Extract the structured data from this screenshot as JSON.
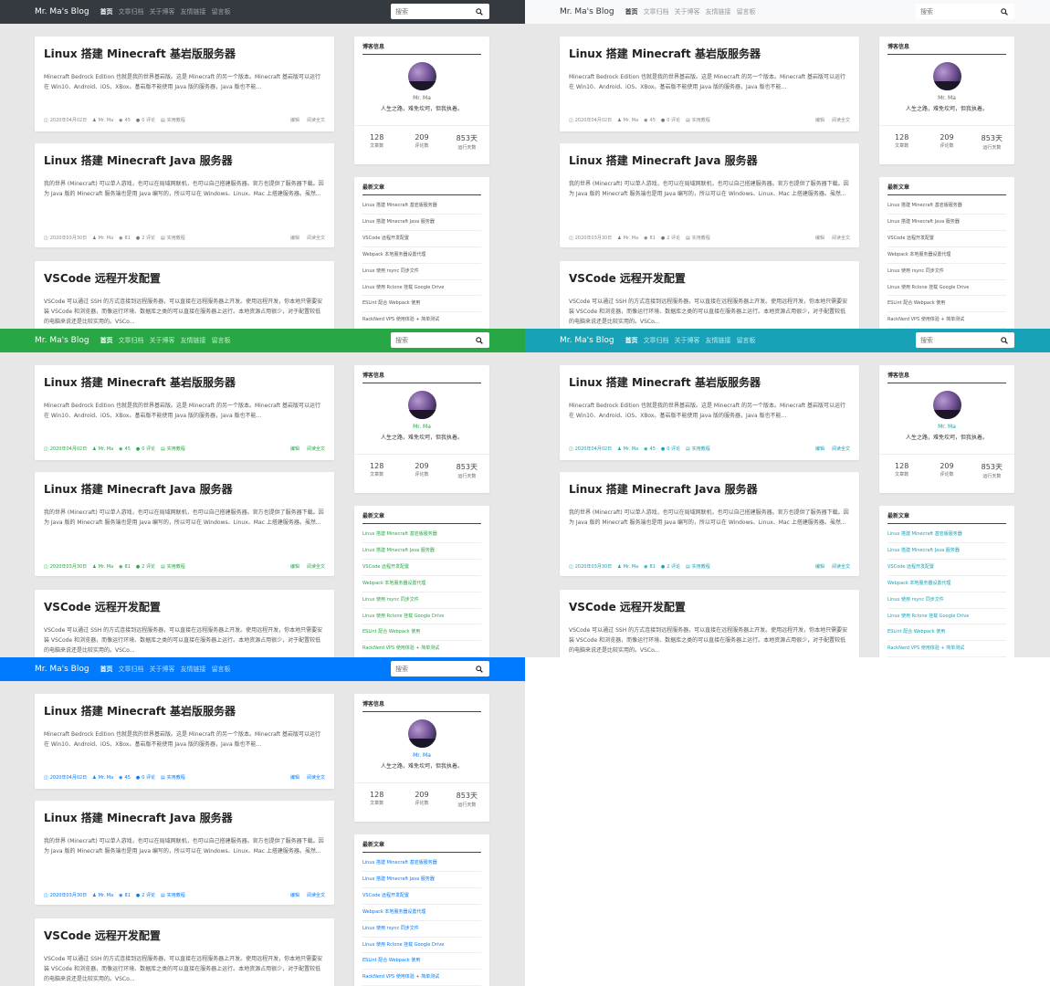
{
  "brand": "Mr. Ma's Blog",
  "nav": [
    "首页",
    "文章归档",
    "关于博客",
    "友情链接",
    "留言板"
  ],
  "search_placeholder": "搜索",
  "search_icon": "magnifier-icon",
  "themes": [
    {
      "name": "dark",
      "nav_bg": "#343a40",
      "brand_color": "#ffffff",
      "nav_text": "#9a9fa5",
      "nav_active": "#ffffff",
      "accent": ""
    },
    {
      "name": "light",
      "nav_bg": "#f8f9fa",
      "brand_color": "#333333",
      "nav_text": "#999999",
      "nav_active": "#333333",
      "accent": ""
    },
    {
      "name": "green",
      "nav_bg": "#28a745",
      "brand_color": "#ffffff",
      "nav_text": "#c6ebce",
      "nav_active": "#ffffff",
      "accent": "#28a745"
    },
    {
      "name": "teal",
      "nav_bg": "#17a2b8",
      "brand_color": "#ffffff",
      "nav_text": "#c1e9ef",
      "nav_active": "#ffffff",
      "accent": "#17a2b8"
    },
    {
      "name": "blue",
      "nav_bg": "#007bff",
      "brand_color": "#ffffff",
      "nav_text": "#bcdcff",
      "nav_active": "#ffffff",
      "accent": "#007bff"
    }
  ],
  "posts": [
    {
      "title": "Linux 搭建 Minecraft 基岩版服务器",
      "excerpt": "Minecraft Bedrock Edition 也就是我的世界基岩版。这是 Minecraft 的另一个版本。Minecraft 基岩版可以运行在 Win10、Android、iOS、XBox。基岩版不能使用 Java 版的服务器，Java 版也不能...",
      "date": "2020年04月02日",
      "author": "Mr. Ma",
      "views": "45",
      "comments": "0 评论",
      "category": "实用教程"
    },
    {
      "title": "Linux 搭建 Minecraft Java 服务器",
      "excerpt": "我的世界 (Minecraft) 可以单人游戏，也可以在局域网联机，也可以自己搭建服务器。官方也提供了服务器下载。因为 Java 版的 Minecraft 服务端也是用 Java 编写的，所以可以在 Windows、Linux、Mac 上搭建服务器。虽然...",
      "date": "2020年03月30日",
      "author": "Mr. Ma",
      "views": "81",
      "comments": "2 评论",
      "category": "实用教程"
    },
    {
      "title": "VSCode 远程开发配置",
      "excerpt": "VSCode 可以通过 SSH 的方式连接到远程服务器，可以直接在远程服务器上开发。使用远程开发，你本地只需要安装 VSCode 和浏览器，而像运行环境、数据库之类的可以直接在服务器上运行。本地资源占用很少，对于配置较低的电脑来说还是比较实用的。VSCo..."
    }
  ],
  "post_actions": {
    "edit": "编辑",
    "read_more": "阅读全文"
  },
  "icons": {
    "date": "calendar-icon",
    "author": "user-icon",
    "views": "eye-icon",
    "comments": "comment-icon",
    "category": "folder-icon"
  },
  "blogger": {
    "title": "博客信息",
    "name": "Mr. Ma",
    "motto": "人生之路，难免坎坷，但我执着。",
    "stats": [
      {
        "num": "128",
        "label": "文章数"
      },
      {
        "num": "209",
        "label": "评论数"
      },
      {
        "num": "853天",
        "label": "运行天数"
      }
    ]
  },
  "latest": {
    "title": "最新文章",
    "items": [
      "Linux 搭建 Minecraft 基岩版服务器",
      "Linux 搭建 Minecraft Java 服务器",
      "VSCode 远程开发配置",
      "Webpack 本地服务器设置代理",
      "Linux 使用 rsync 同步文件",
      "Linux 使用 Rclone 挂载 Google Drive",
      "ESLint 配合 Webpack 使用",
      "RackNerd VPS 使用体验 + 简单测试"
    ]
  }
}
